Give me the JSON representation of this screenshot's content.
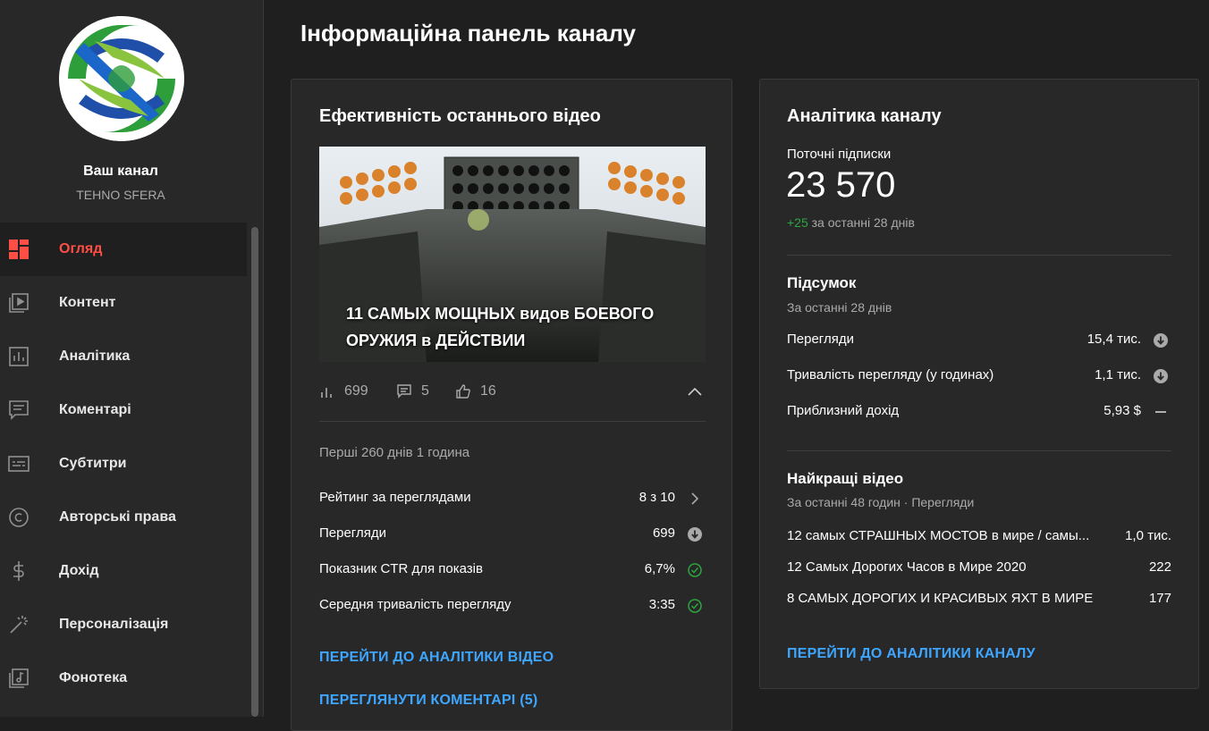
{
  "channel": {
    "title": "Ваш канал",
    "name": "TEHNO SFERA"
  },
  "sidebar": {
    "items": [
      {
        "label": "Огляд",
        "icon": "dashboard-icon",
        "active": true
      },
      {
        "label": "Контент",
        "icon": "content-icon"
      },
      {
        "label": "Аналітика",
        "icon": "analytics-icon"
      },
      {
        "label": "Коментарі",
        "icon": "comments-icon"
      },
      {
        "label": "Субтитри",
        "icon": "subtitles-icon"
      },
      {
        "label": "Авторські права",
        "icon": "copyright-icon"
      },
      {
        "label": "Дохід",
        "icon": "dollar-icon"
      },
      {
        "label": "Персоналізація",
        "icon": "magic-wand-icon"
      },
      {
        "label": "Фонотека",
        "icon": "audio-library-icon"
      }
    ]
  },
  "page": {
    "title": "Інформаційна панель каналу"
  },
  "latest_video": {
    "card_title": "Ефективність останнього відео",
    "thumbnail_text": "11 САМЫХ МОЩНЫХ видов БОЕВОГО ОРУЖИЯ в ДЕЙСТВИИ",
    "views": "699",
    "comments": "5",
    "likes": "16",
    "period": "Перші 260 днів 1 година",
    "metrics": [
      {
        "label": "Рейтинг за переглядами",
        "value": "8 з 10",
        "indicator": "chevron-right-icon"
      },
      {
        "label": "Перегляди",
        "value": "699",
        "indicator": "arrow-down-circle-icon"
      },
      {
        "label": "Показник CTR для показів",
        "value": "6,7%",
        "indicator": "check-circle-icon"
      },
      {
        "label": "Середня тривалість перегляду",
        "value": "3:35",
        "indicator": "check-circle-icon"
      }
    ],
    "link_analytics": "ПЕРЕЙТИ ДО АНАЛІТИКИ ВІДЕО",
    "link_comments": "ПЕРЕГЛЯНУТИ КОМЕНТАРІ (5)"
  },
  "channel_analytics": {
    "card_title": "Аналітика каналу",
    "subs_label": "Поточні підписки",
    "subs_value": "23 570",
    "subs_delta": "+25",
    "subs_delta_text": " за останні 28 днів",
    "summary_title": "Підсумок",
    "summary_period": "За останні 28 днів",
    "summary": [
      {
        "label": "Перегляди",
        "value": "15,4 тис.",
        "indicator": "arrow-down-circle-icon"
      },
      {
        "label": "Тривалість перегляду (у годинах)",
        "value": "1,1 тис.",
        "indicator": "arrow-down-circle-icon"
      },
      {
        "label": "Приблизний дохід",
        "value": "5,93 $",
        "indicator": "dash-icon"
      }
    ],
    "top_title": "Найкращі відео",
    "top_period": "За останні 48 годин · Перегляди",
    "top_videos": [
      {
        "title": "12 самых СТРАШНЫХ МОСТОВ в мире / самы...",
        "views": "1,0 тис."
      },
      {
        "title": "12 Самых Дорогих Часов в Мире 2020",
        "views": "222"
      },
      {
        "title": "8 САМЫХ ДОРОГИХ И КРАСИВЫХ ЯХТ В МИРЕ",
        "views": "177"
      }
    ],
    "link_channel": "ПЕРЕЙТИ ДО АНАЛІТИКИ КАНАЛУ"
  },
  "colors": {
    "accent_red": "#ff4e45",
    "link_blue": "#3ea6ff",
    "positive_green": "#2ba640"
  }
}
